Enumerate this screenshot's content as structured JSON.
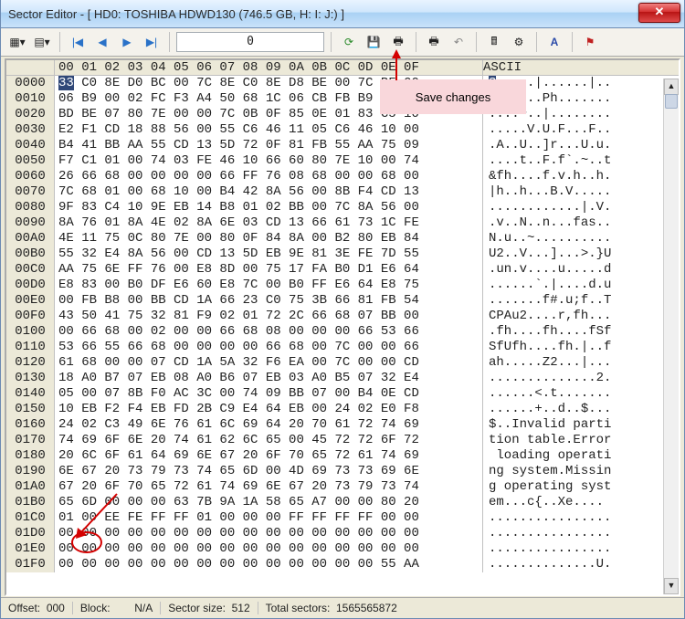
{
  "window": {
    "title": "Sector Editor - [ HD0: TOSHIBA HDWD130 (746.5 GB, H: I: J:) ]",
    "close_glyph": "✕"
  },
  "toolbar": {
    "offset_value": "0",
    "icons": {
      "dropdown1": "▦▾",
      "dropdown2": "▤▾",
      "nav_first": "|◀",
      "nav_prev": "◀",
      "nav_next": "▶",
      "nav_last": "▶|",
      "refresh": "⟳",
      "save": "💾",
      "print": "🖶",
      "print2": "🖶",
      "undo": "↶",
      "calc": "🖩",
      "tool": "⚙",
      "font": "A",
      "flag": "⚑"
    }
  },
  "callout": {
    "save_changes": "Save changes"
  },
  "hex": {
    "col_header_bytes": [
      "00",
      "01",
      "02",
      "03",
      "04",
      "05",
      "06",
      "07",
      "08",
      "09",
      "0A",
      "0B",
      "0C",
      "0D",
      "0E",
      "0F"
    ],
    "ascii_label": "ASCII",
    "rows": [
      {
        "addr": "0000",
        "hex": "33 C0 8E D0 BC 00 7C 8E C0 8E D8 BE 00 7C BF 00",
        "asc": "3.....|......|.."
      },
      {
        "addr": "0010",
        "hex": "06 B9 00 02 FC F3 A4 50 68 1C 06 CB FB B9 04 00",
        "asc": ".......Ph......."
      },
      {
        "addr": "0020",
        "hex": "BD BE 07 80 7E 00 00 7C 0B 0F 85 0E 01 83 C5 10",
        "asc": "....~..|........"
      },
      {
        "addr": "0030",
        "hex": "E2 F1 CD 18 88 56 00 55 C6 46 11 05 C6 46 10 00",
        "asc": ".....V.U.F...F.."
      },
      {
        "addr": "0040",
        "hex": "B4 41 BB AA 55 CD 13 5D 72 0F 81 FB 55 AA 75 09",
        "asc": ".A..U..]r...U.u."
      },
      {
        "addr": "0050",
        "hex": "F7 C1 01 00 74 03 FE 46 10 66 60 80 7E 10 00 74",
        "asc": "....t..F.f`.~..t"
      },
      {
        "addr": "0060",
        "hex": "26 66 68 00 00 00 00 66 FF 76 08 68 00 00 68 00",
        "asc": "&fh....f.v.h..h."
      },
      {
        "addr": "0070",
        "hex": "7C 68 01 00 68 10 00 B4 42 8A 56 00 8B F4 CD 13",
        "asc": "|h..h...B.V....."
      },
      {
        "addr": "0080",
        "hex": "9F 83 C4 10 9E EB 14 B8 01 02 BB 00 7C 8A 56 00",
        "asc": "............|.V."
      },
      {
        "addr": "0090",
        "hex": "8A 76 01 8A 4E 02 8A 6E 03 CD 13 66 61 73 1C FE",
        "asc": ".v..N..n...fas.."
      },
      {
        "addr": "00A0",
        "hex": "4E 11 75 0C 80 7E 00 80 0F 84 8A 00 B2 80 EB 84",
        "asc": "N.u..~.........."
      },
      {
        "addr": "00B0",
        "hex": "55 32 E4 8A 56 00 CD 13 5D EB 9E 81 3E FE 7D 55",
        "asc": "U2..V...]...>.}U"
      },
      {
        "addr": "00C0",
        "hex": "AA 75 6E FF 76 00 E8 8D 00 75 17 FA B0 D1 E6 64",
        "asc": ".un.v....u.....d"
      },
      {
        "addr": "00D0",
        "hex": "E8 83 00 B0 DF E6 60 E8 7C 00 B0 FF E6 64 E8 75",
        "asc": "......`.|....d.u"
      },
      {
        "addr": "00E0",
        "hex": "00 FB B8 00 BB CD 1A 66 23 C0 75 3B 66 81 FB 54",
        "asc": ".......f#.u;f..T"
      },
      {
        "addr": "00F0",
        "hex": "43 50 41 75 32 81 F9 02 01 72 2C 66 68 07 BB 00",
        "asc": "CPAu2....r,fh..."
      },
      {
        "addr": "0100",
        "hex": "00 66 68 00 02 00 00 66 68 08 00 00 00 66 53 66",
        "asc": ".fh....fh....fSf"
      },
      {
        "addr": "0110",
        "hex": "53 66 55 66 68 00 00 00 00 66 68 00 7C 00 00 66",
        "asc": "SfUfh....fh.|..f"
      },
      {
        "addr": "0120",
        "hex": "61 68 00 00 07 CD 1A 5A 32 F6 EA 00 7C 00 00 CD",
        "asc": "ah.....Z2...|..."
      },
      {
        "addr": "0130",
        "hex": "18 A0 B7 07 EB 08 A0 B6 07 EB 03 A0 B5 07 32 E4",
        "asc": "..............2."
      },
      {
        "addr": "0140",
        "hex": "05 00 07 8B F0 AC 3C 00 74 09 BB 07 00 B4 0E CD",
        "asc": "......<.t......."
      },
      {
        "addr": "0150",
        "hex": "10 EB F2 F4 EB FD 2B C9 E4 64 EB 00 24 02 E0 F8",
        "asc": "......+..d..$..."
      },
      {
        "addr": "0160",
        "hex": "24 02 C3 49 6E 76 61 6C 69 64 20 70 61 72 74 69",
        "asc": "$..Invalid parti"
      },
      {
        "addr": "0170",
        "hex": "74 69 6F 6E 20 74 61 62 6C 65 00 45 72 72 6F 72",
        "asc": "tion table.Error"
      },
      {
        "addr": "0180",
        "hex": "20 6C 6F 61 64 69 6E 67 20 6F 70 65 72 61 74 69",
        "asc": " loading operati"
      },
      {
        "addr": "0190",
        "hex": "6E 67 20 73 79 73 74 65 6D 00 4D 69 73 73 69 6E",
        "asc": "ng system.Missin"
      },
      {
        "addr": "01A0",
        "hex": "67 20 6F 70 65 72 61 74 69 6E 67 20 73 79 73 74",
        "asc": "g operating syst"
      },
      {
        "addr": "01B0",
        "hex": "65 6D 00 00 00 63 7B 9A 1A 58 65 A7 00 00 80 20",
        "asc": "em...c{..Xe.... "
      },
      {
        "addr": "01C0",
        "hex": "01 00 EE FE FF FF 01 00 00 00 FF FF FF FF 00 00",
        "asc": "................"
      },
      {
        "addr": "01D0",
        "hex": "00 00 00 00 00 00 00 00 00 00 00 00 00 00 00 00",
        "asc": "................"
      },
      {
        "addr": "01E0",
        "hex": "00 00 00 00 00 00 00 00 00 00 00 00 00 00 00 00",
        "asc": "................"
      },
      {
        "addr": "01F0",
        "hex": "00 00 00 00 00 00 00 00 00 00 00 00 00 00 55 AA",
        "asc": "..............U."
      }
    ]
  },
  "status": {
    "offset_label": "Offset:",
    "offset_value": "000",
    "block_label": "Block:",
    "block_value": "N/A",
    "sector_size_label": "Sector size:",
    "sector_size_value": "512",
    "total_sectors_label": "Total sectors:",
    "total_sectors_value": "1565565872"
  }
}
